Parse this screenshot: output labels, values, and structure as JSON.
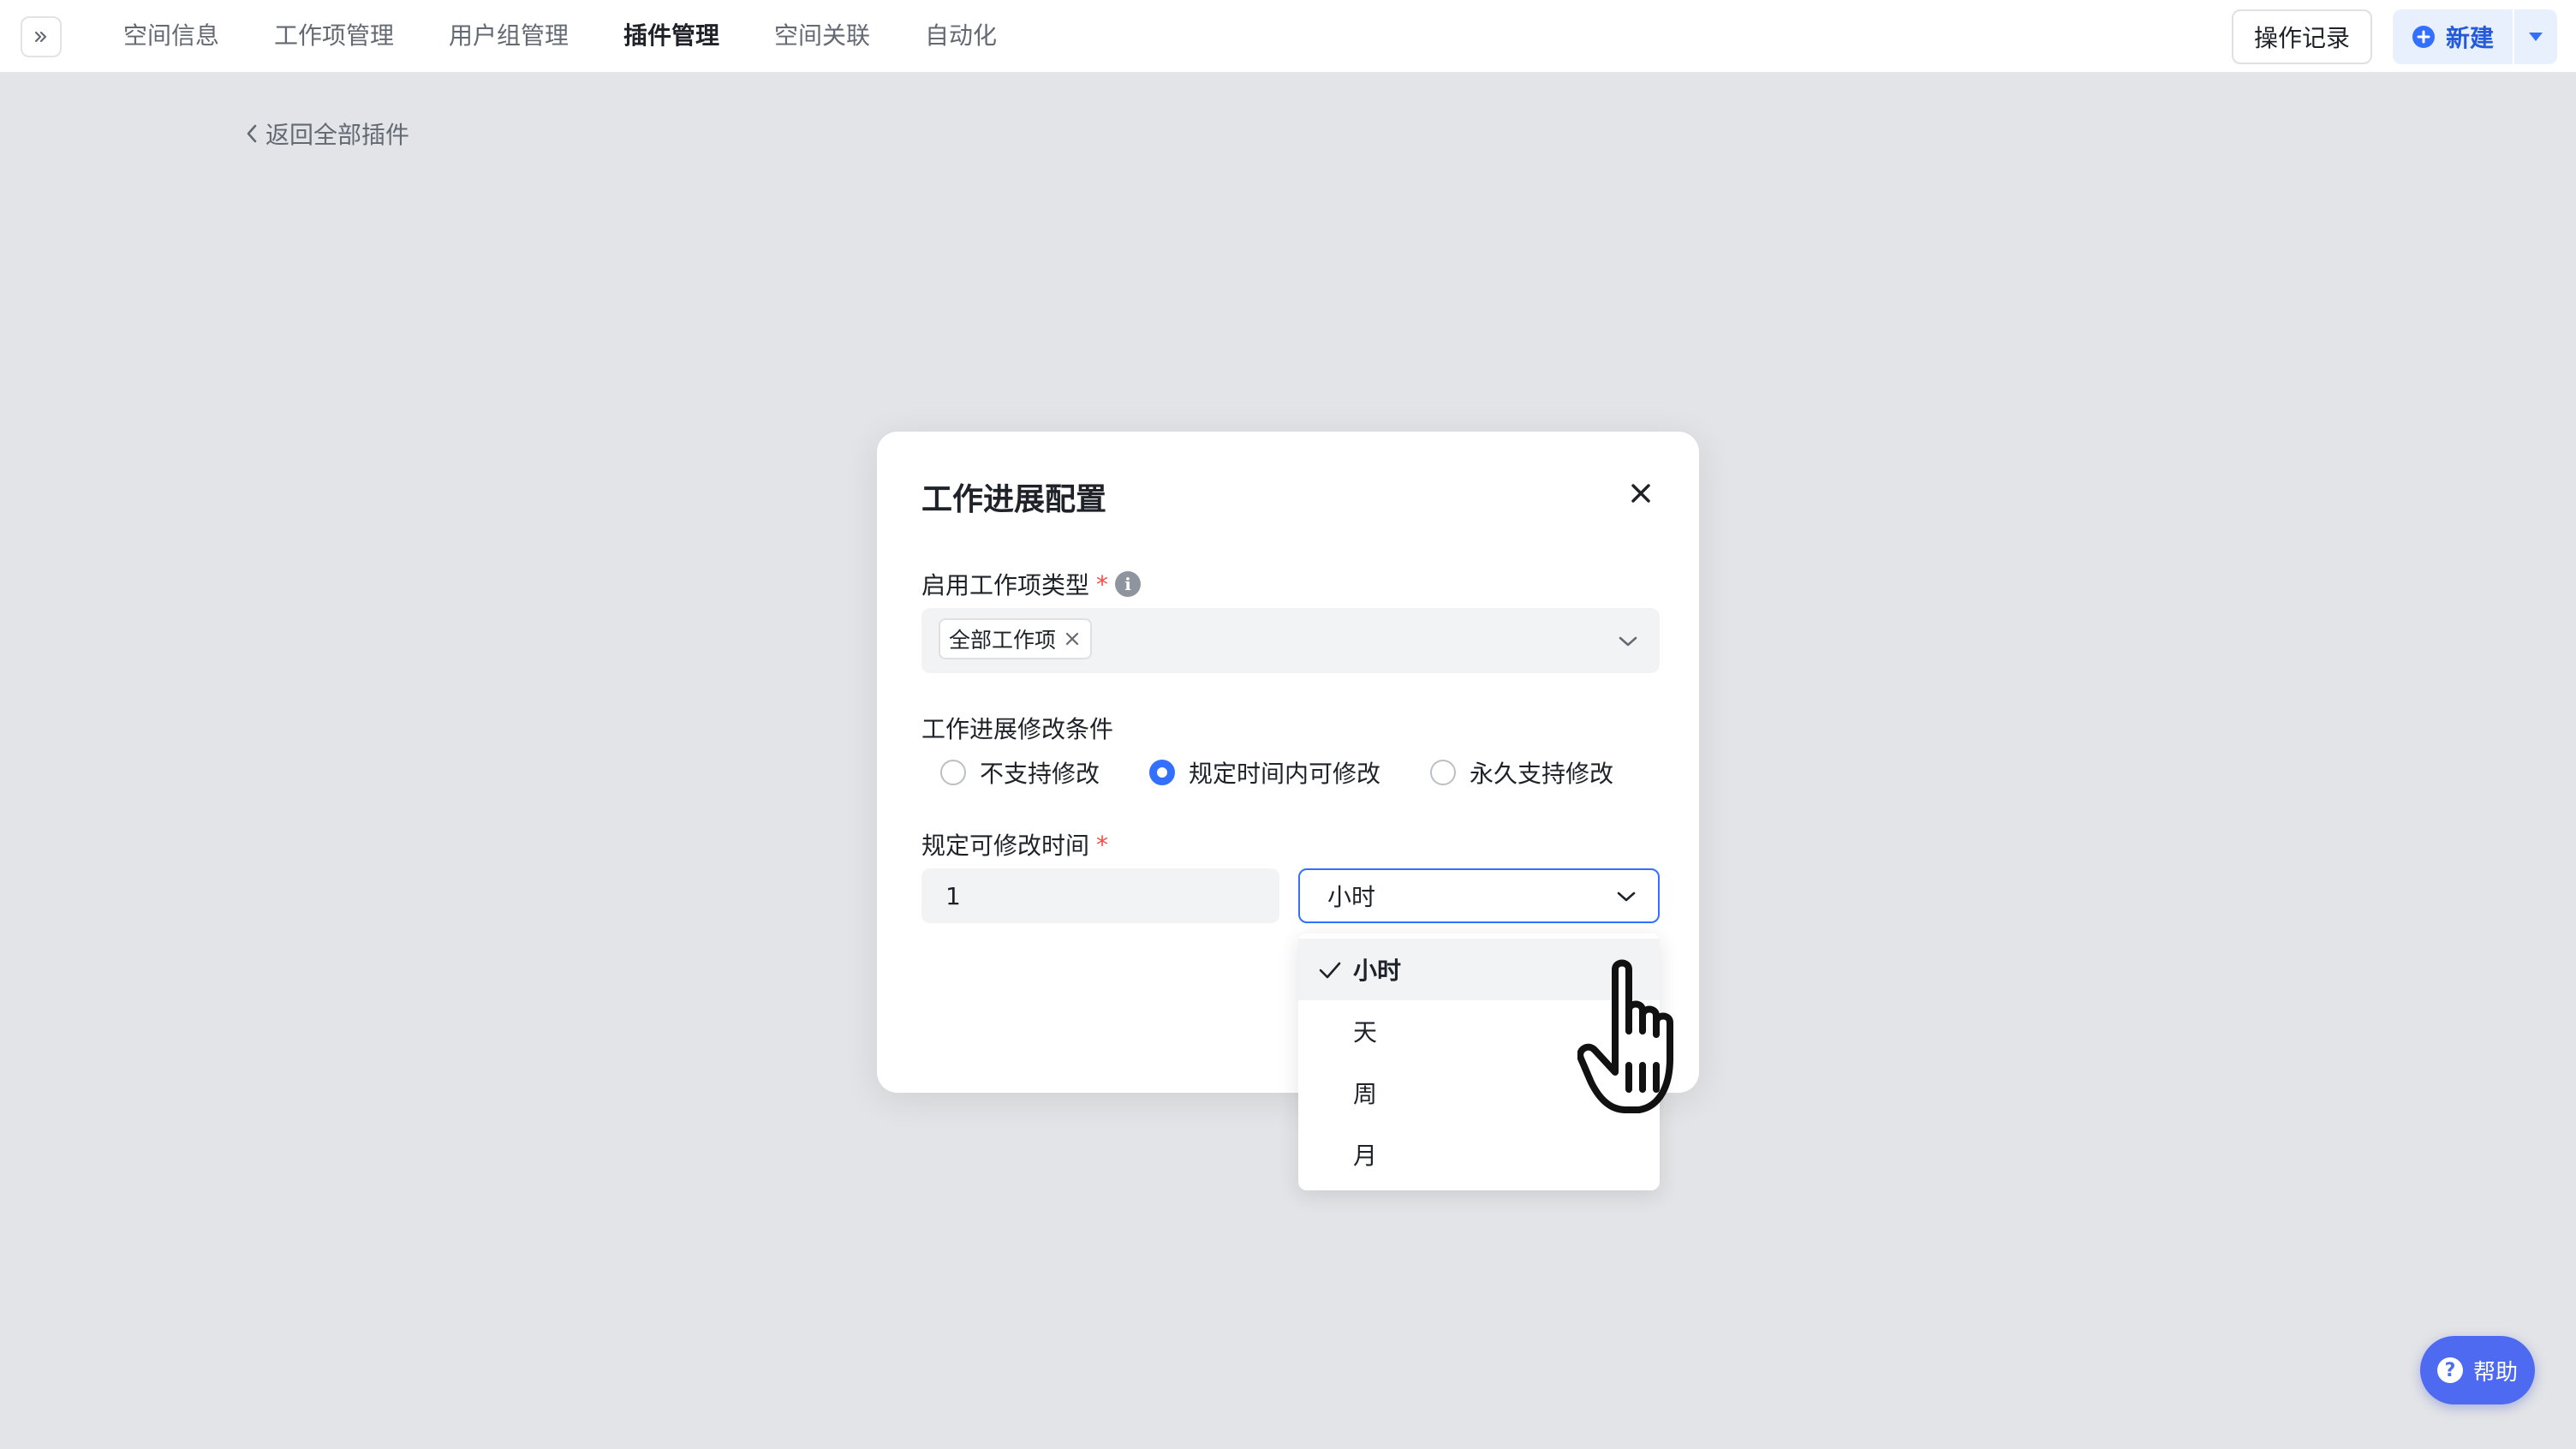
{
  "nav": {
    "expand_icon": "double-chevron-right-icon",
    "tabs": [
      {
        "label": "空间信息"
      },
      {
        "label": "工作项管理"
      },
      {
        "label": "用户组管理"
      },
      {
        "label": "插件管理",
        "active": true
      },
      {
        "label": "空间关联"
      },
      {
        "label": "自动化"
      }
    ],
    "op_record_label": "操作记录",
    "new_label": "新建"
  },
  "back_link": "返回全部插件",
  "modal": {
    "title": "工作进展配置",
    "enable_type": {
      "label": "启用工作项类型",
      "required_mark": "*",
      "tag": "全部工作项"
    },
    "modify_condition": {
      "label": "工作进展修改条件",
      "options": [
        {
          "label": "不支持修改",
          "checked": false
        },
        {
          "label": "规定时间内可修改",
          "checked": true
        },
        {
          "label": "永久支持修改",
          "checked": false
        }
      ]
    },
    "modify_time": {
      "label": "规定可修改时间",
      "required_mark": "*",
      "value": "1",
      "unit": "小时"
    }
  },
  "dropdown": {
    "options": [
      {
        "label": "小时",
        "selected": true
      },
      {
        "label": "天"
      },
      {
        "label": "周"
      },
      {
        "label": "月"
      }
    ]
  },
  "help": {
    "label": "帮助"
  },
  "colors": {
    "accent": "#3370ff",
    "required": "#f54a45",
    "help_bg": "#4e6af0",
    "backdrop": "#e3e4e7"
  }
}
